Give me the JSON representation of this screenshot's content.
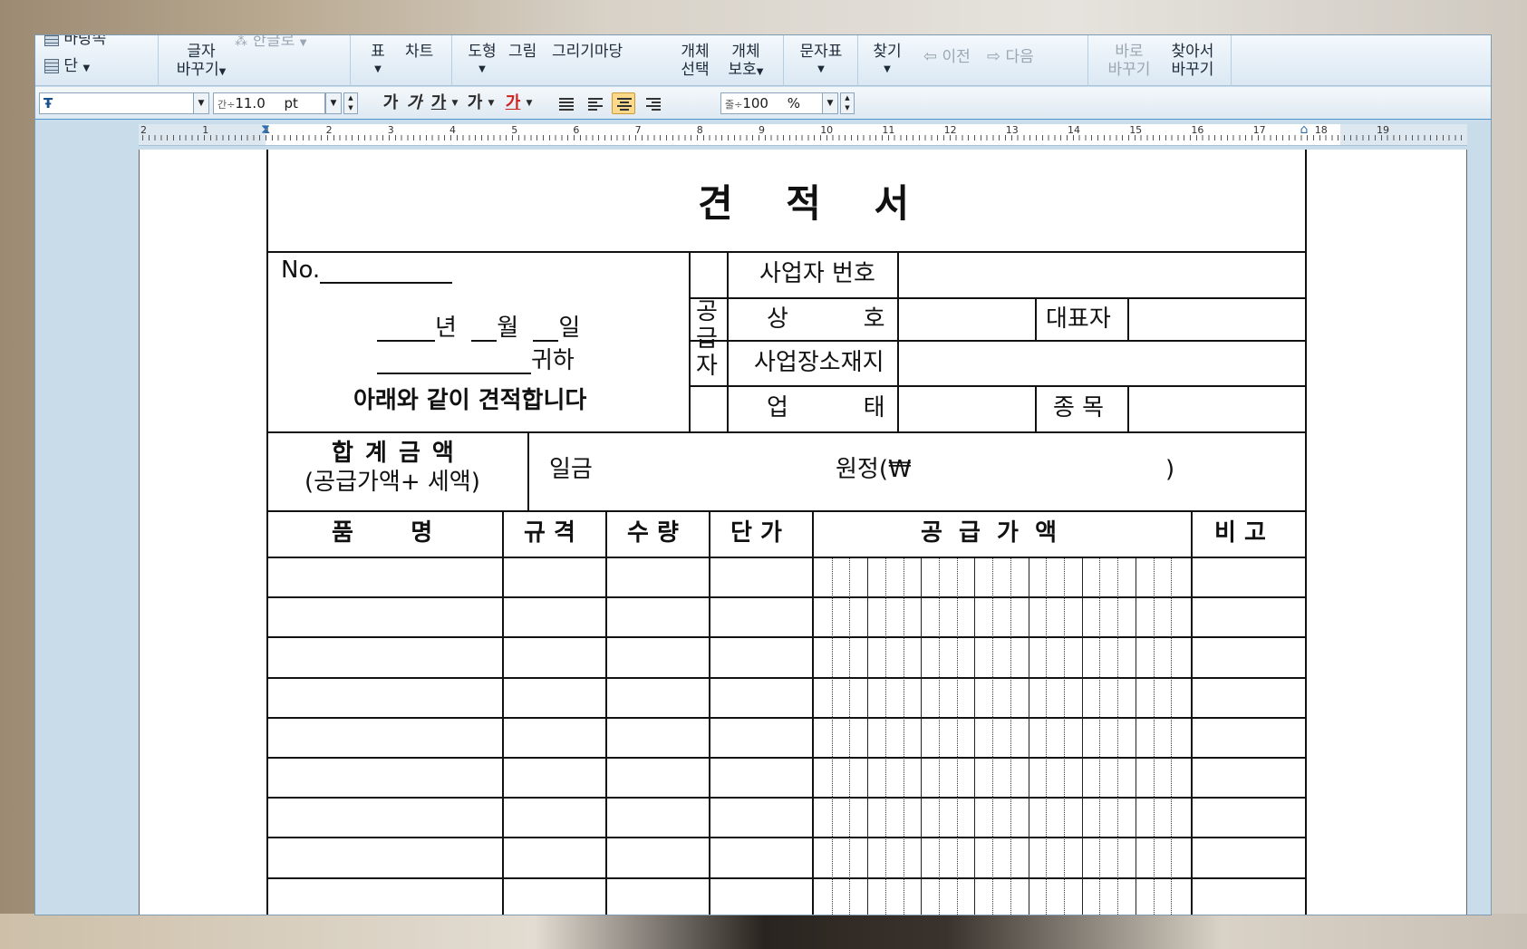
{
  "ribbon": {
    "background_label": "바탕쪽",
    "column_label": "단",
    "char_label_1": "글자",
    "char_label_2": "바꾸기",
    "hangul_label": "한글로",
    "table_label": "표",
    "chart_label": "차트",
    "shape_label": "도형",
    "picture_label": "그림",
    "drawing_wizard_label": "그리기마당",
    "object_select_1": "개체",
    "object_select_2": "선택",
    "object_protect_1": "개체",
    "object_protect_2": "보호",
    "char_map_label": "문자표",
    "find_label": "찾기",
    "prev_label": "이전",
    "next_label": "다음",
    "replace_now_1": "바로",
    "replace_now_2": "바꾸기",
    "find_replace_1": "찾아서",
    "find_replace_2": "바꾸기"
  },
  "format_bar": {
    "style_value": "",
    "font_size_value": "11.0",
    "font_size_unit": "pt",
    "bold_label": "가",
    "italic_label": "가",
    "underline_label": "가",
    "strike_label": "가",
    "color_label": "가",
    "line_spacing_value": "100",
    "line_spacing_unit": "%",
    "font_color": "#d02020"
  },
  "ruler": {
    "labels": [
      "2",
      "1",
      "1",
      "2",
      "3",
      "4",
      "5",
      "6",
      "7",
      "8",
      "9",
      "10",
      "11",
      "12",
      "13",
      "14",
      "15",
      "16",
      "17",
      "18",
      "19"
    ]
  },
  "form": {
    "title": "견 적 서",
    "no_label": "No.",
    "year_label": "년",
    "month_label": "월",
    "day_label": "일",
    "recipient_suffix": "귀하",
    "statement": "아래와 같이 견적합니다",
    "supplier_1": "공",
    "supplier_2": "급",
    "supplier_3": "자",
    "biz_number": "사업자 번호",
    "company_name": "상          호",
    "representative": "대표자",
    "address": "사업장소재지",
    "business_type": "업          태",
    "business_item": "종 목",
    "total_label": "합 계 금 액",
    "total_sub": "(공급가액+ 세액)",
    "amount_prefix": "일금",
    "amount_won": "원정(₩",
    "amount_close": ")",
    "col_item": "품       명",
    "col_spec": "규 격",
    "col_qty": "수 량",
    "col_unit_price": "단 가",
    "col_supply": "공  급  가  액",
    "col_note": "비 고"
  }
}
